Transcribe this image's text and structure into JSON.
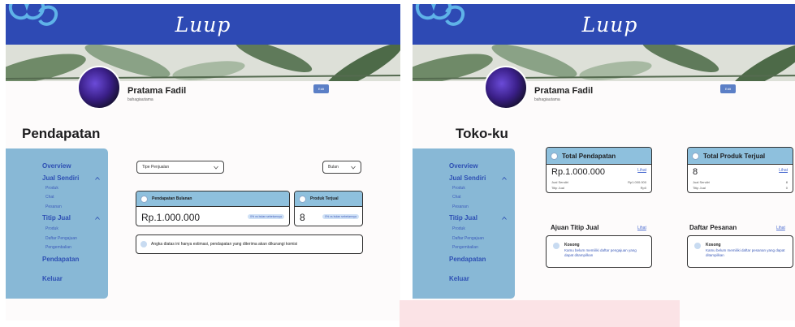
{
  "brand": "Luup",
  "profile": {
    "name": "Pratama Fadil",
    "handle": "bahagiautama",
    "edit_label": "Edit"
  },
  "colors": {
    "header": "#2e4ab4",
    "sidebar": "#88b8d6",
    "accent": "#2d4fb3",
    "card_header": "#8ec0dd"
  },
  "sidebar": {
    "overview": "Overview",
    "jual_sendiri": "Jual Sendiri",
    "jual_sendiri_items": [
      "Produk",
      "Chat",
      "Pesanan"
    ],
    "titip_jual": "Titip Jual",
    "titip_jual_items": [
      "Produk",
      "Daftar Pengajuan",
      "Pengembalian"
    ],
    "pendapatan": "Pendapatan",
    "keluar": "Keluar"
  },
  "left": {
    "title": "Pendapatan",
    "filter_type": "Tipe Penjualan",
    "filter_period": "Bulan",
    "income_card": {
      "title": "Pendapatan Bulanan",
      "value": "Rp.1.000.000",
      "badge": "0% vs bulan sebelumnya"
    },
    "sold_card": {
      "title": "Produk Terjual",
      "value": "8",
      "badge": "0% vs bulan sebelumnya"
    },
    "note": "Angka diatas ini hanya estimasi, pendapatan yang diterima akan dikurangi komisi"
  },
  "right": {
    "title": "Toko-ku",
    "total_income": {
      "title": "Total Pendapatan",
      "value": "Rp.1.000.000",
      "link": "Lihat",
      "rows": [
        {
          "label": "Jual Sendiri",
          "value": "Rp1.000.000"
        },
        {
          "label": "Titip Jual",
          "value": "Rp0"
        }
      ]
    },
    "total_sold": {
      "title": "Total Produk Terjual",
      "value": "8",
      "link": "Lihat",
      "rows": [
        {
          "label": "Jual Sendiri",
          "value": "8"
        },
        {
          "label": "Titip Jual",
          "value": "0"
        }
      ]
    },
    "ajuan": {
      "title": "Ajuan Titip Jual",
      "link": "Lihat",
      "empty_title": "Kosong",
      "empty_desc": "Kamu belum memiliki daftar pengajuan yang dapat ditampilkan"
    },
    "pesanan": {
      "title": "Daftar Pesanan",
      "link": "Lihat",
      "empty_title": "Kosong",
      "empty_desc": "Kamu belum memiliki daftar pesanan yang dapat ditampilkan"
    }
  }
}
